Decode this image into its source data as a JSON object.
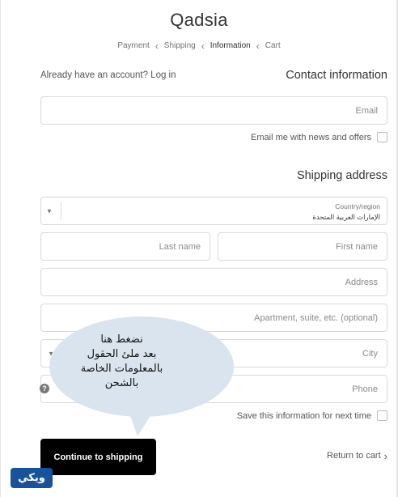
{
  "store": {
    "name": "Qadsia"
  },
  "breadcrumb": {
    "items": [
      "Payment",
      "Shipping",
      "Information",
      "Cart"
    ],
    "current": "Information"
  },
  "contact": {
    "already_text": "Already have an account? Log in",
    "heading": "Contact information",
    "email_placeholder": "Email",
    "newsletter_label": "Email me with news and offers"
  },
  "shipping": {
    "heading": "Shipping address",
    "country_label": "Country/region",
    "country_value": "الإمارات العربية المتحدة",
    "last_name_placeholder": "Last name",
    "first_name_placeholder": "First name",
    "address_placeholder": "Address",
    "apartment_placeholder": "Apartment, suite, etc. (optional)",
    "city_placeholder": "City",
    "phone_placeholder": "Phone",
    "save_info_label": "Save this information for next time"
  },
  "actions": {
    "continue_label": "Continue to shipping",
    "return_label": "Return to cart"
  },
  "annotation": {
    "lines": [
      "نضغط هنا",
      "بعد ملئ الحقول",
      "بالمعلومات الخاصة",
      "بالشحن"
    ]
  },
  "watermark": {
    "text": "ويكي"
  },
  "colors": {
    "button": "#000000",
    "callout_fill": "#d9e4ee",
    "watermark_bg": "#17539a"
  },
  "icons": {
    "breadcrumb_separator": "chevron-left-icon",
    "help": "question-icon",
    "return": "chevron-right-icon",
    "dropdown": "caret-down-icon"
  }
}
